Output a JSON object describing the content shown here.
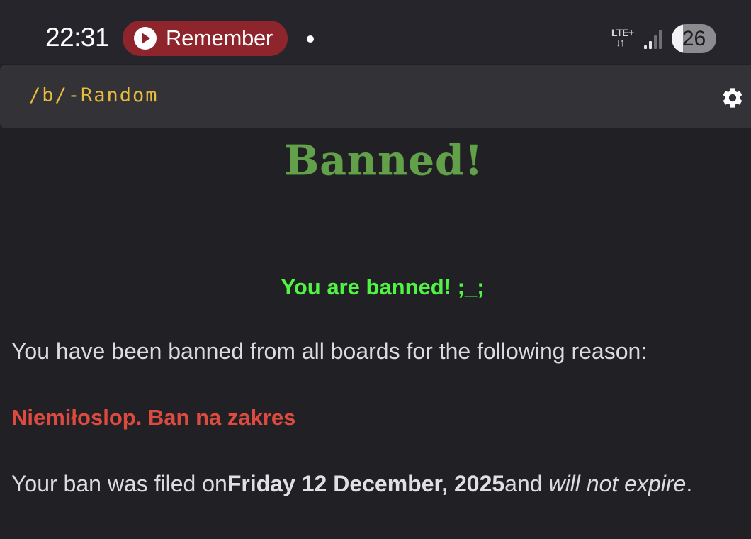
{
  "status_bar": {
    "time": "22:31",
    "recording_chip": {
      "label": "Remember",
      "icon": "play-icon"
    },
    "network_type": "LTE+",
    "data_arrows": "↓↑",
    "battery_level": "26",
    "icons": [
      "notification-dot-icon",
      "lte-icon",
      "signal-icon",
      "battery-icon"
    ]
  },
  "header": {
    "board_title": "/b/-Random",
    "settings_icon": "gear-icon"
  },
  "ban_page": {
    "title": "Banned!",
    "subtitle": "You are banned! ;_;",
    "reason_intro": "You have been banned from all boards for the following reason:",
    "reason": "Niemiłoslop. Ban na zakres",
    "filed_prefix": "Your ban was filed on",
    "filed_date": "Friday 12 December, 2025",
    "filed_middle": "and ",
    "expiry": "will not expire",
    "filed_suffix": "."
  },
  "colors": {
    "background": "#212125",
    "status_bar": "#25252b",
    "header": "#323237",
    "board_title": "#e8bc3c",
    "banned_title": "#62a04a",
    "banned_subtitle": "#4ff542",
    "reason": "#dd4a40",
    "recording_chip": "#8e252d",
    "body_text": "#dcdcde"
  }
}
